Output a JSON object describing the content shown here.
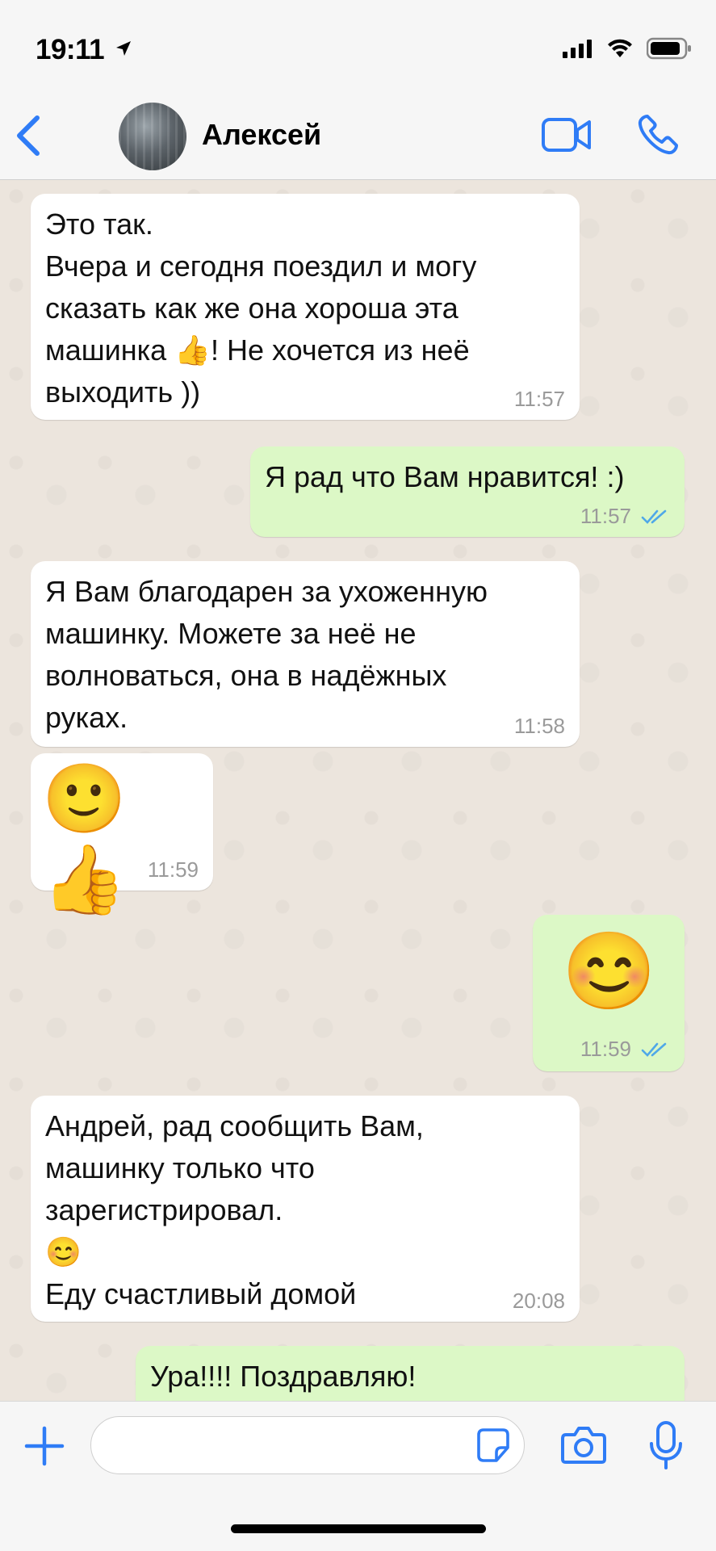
{
  "status": {
    "time": "19:11"
  },
  "header": {
    "contact_name": "Алексей"
  },
  "messages": [
    {
      "direction": "in",
      "text": "Это так.\nВчера и сегодня поездил и могу\nсказать как же она хороша  эта\nмашинка 👍! Не хочется из неё\nвыходить ))",
      "time": "11:57"
    },
    {
      "direction": "out",
      "text": "Я рад что Вам нравится! :)",
      "time": "11:57",
      "read": true
    },
    {
      "direction": "in",
      "text": "Я Вам благодарен за ухоженную\nмашинку. Можете за неё не\nволноваться, она в надёжных\nруках.",
      "time": "11:58"
    },
    {
      "direction": "in",
      "emoji": "🙂👍",
      "time": "11:59"
    },
    {
      "direction": "out",
      "emoji": "😊",
      "time": "11:59",
      "read": true
    },
    {
      "direction": "in",
      "text": "Андрей, рад сообщить Вам,\nмашинку только что\nзарегистрировал.\n😊\nЕду счастливый  домой",
      "time": "20:08"
    },
    {
      "direction": "out",
      "text": "Ура!!!! Поздравляю!"
    }
  ],
  "colors": {
    "accent": "#2f7cf6",
    "incoming": "#ffffff",
    "outgoing": "#dcf8c6",
    "read_ticks": "#4fa8e8"
  }
}
